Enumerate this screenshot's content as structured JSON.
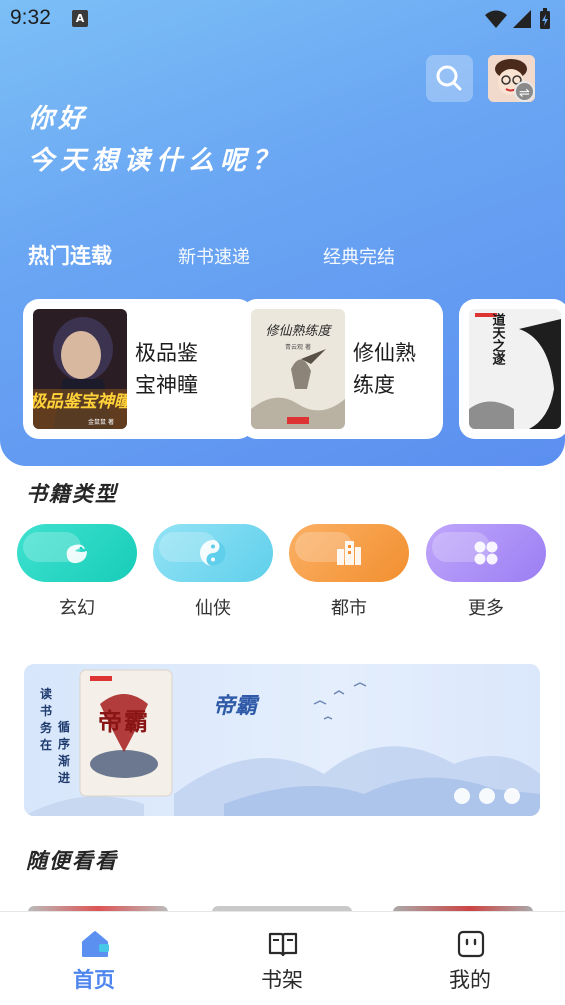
{
  "status_bar": {
    "time": "9:32",
    "notif_icon_letter": "A",
    "icons": [
      "wifi-icon",
      "signal-icon",
      "battery-icon"
    ]
  },
  "header": {
    "greeting_line1": "你好",
    "greeting_line2": "今天想读什么呢？",
    "search_icon": "search-icon",
    "avatar_icon": "avatar",
    "swap_badge": "⇌"
  },
  "tabs": [
    {
      "label": "热门连载",
      "active": true
    },
    {
      "label": "新书速递",
      "active": false
    },
    {
      "label": "经典完结",
      "active": false
    }
  ],
  "featured_books": [
    {
      "title": "极品鉴宝神瞳",
      "cover_text": "极品鉴宝神瞳",
      "cover_author": "金鼠鼠 著"
    },
    {
      "title": "修仙熟练度",
      "cover_text": "修仙熟练度",
      "cover_author": "青云观 著"
    },
    {
      "title": "",
      "cover_text": "道天之遂"
    }
  ],
  "categories_section": {
    "title": "书籍类型",
    "items": [
      {
        "label": "玄幻",
        "icon": "dragon-icon",
        "color": "#1fd6c2"
      },
      {
        "label": "仙侠",
        "icon": "yin-yang-icon",
        "color": "#6fd6ef"
      },
      {
        "label": "都市",
        "icon": "building-icon",
        "color": "#f79a3e"
      },
      {
        "label": "更多",
        "icon": "grid-icon",
        "color": "#a98af5"
      }
    ]
  },
  "banner": {
    "book_title": "帝霸",
    "slogan_col1": "读书务在",
    "slogan_col2": "循序渐进",
    "cover_text": "帝霸",
    "dots": 3
  },
  "random_section": {
    "title": "随便看看"
  },
  "bottom_nav": [
    {
      "label": "首页",
      "icon": "home-icon",
      "active": true
    },
    {
      "label": "书架",
      "icon": "book-icon",
      "active": false
    },
    {
      "label": "我的",
      "icon": "profile-icon",
      "active": false
    }
  ],
  "colors": {
    "accent": "#4f86ee",
    "hero_top": "#7cbff6",
    "hero_bottom": "#5c8ff0"
  }
}
